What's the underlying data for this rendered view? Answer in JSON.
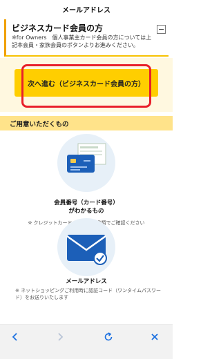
{
  "topbar": {
    "title": "メールアドレス"
  },
  "business": {
    "heading": "ビジネスカード会員の方",
    "description": "※for Owners　個人事業主カード会員の方については上記本会員・家族会員のボタンよりお進みください。",
    "collapse_icon": "minus-icon"
  },
  "next_button": {
    "label": "次へ進む（ビジネスカード会員の方）"
  },
  "prep": {
    "heading": "ご用意いただくもの",
    "items": [
      {
        "icon": "credit-card-icon",
        "title_line1": "会員番号（カード番号）",
        "title_line2": "がわかるもの",
        "note": "※ クレジットカードまたは郵送書類でご確認ください"
      },
      {
        "icon": "envelope-icon",
        "title_line1": "メールアドレス",
        "note": "※ ネットショッピングご利用時に認証コード（ワンタイムパスワード）をお送りいたします"
      }
    ]
  },
  "toolbar": {
    "icons": [
      "back-icon",
      "forward-icon",
      "reload-icon",
      "close-icon"
    ]
  },
  "colors": {
    "accent_yellow": "#ffce00",
    "section_bg": "#ffe38a",
    "highlight_red": "#e8202a",
    "icon_blue": "#1c5fb8"
  }
}
